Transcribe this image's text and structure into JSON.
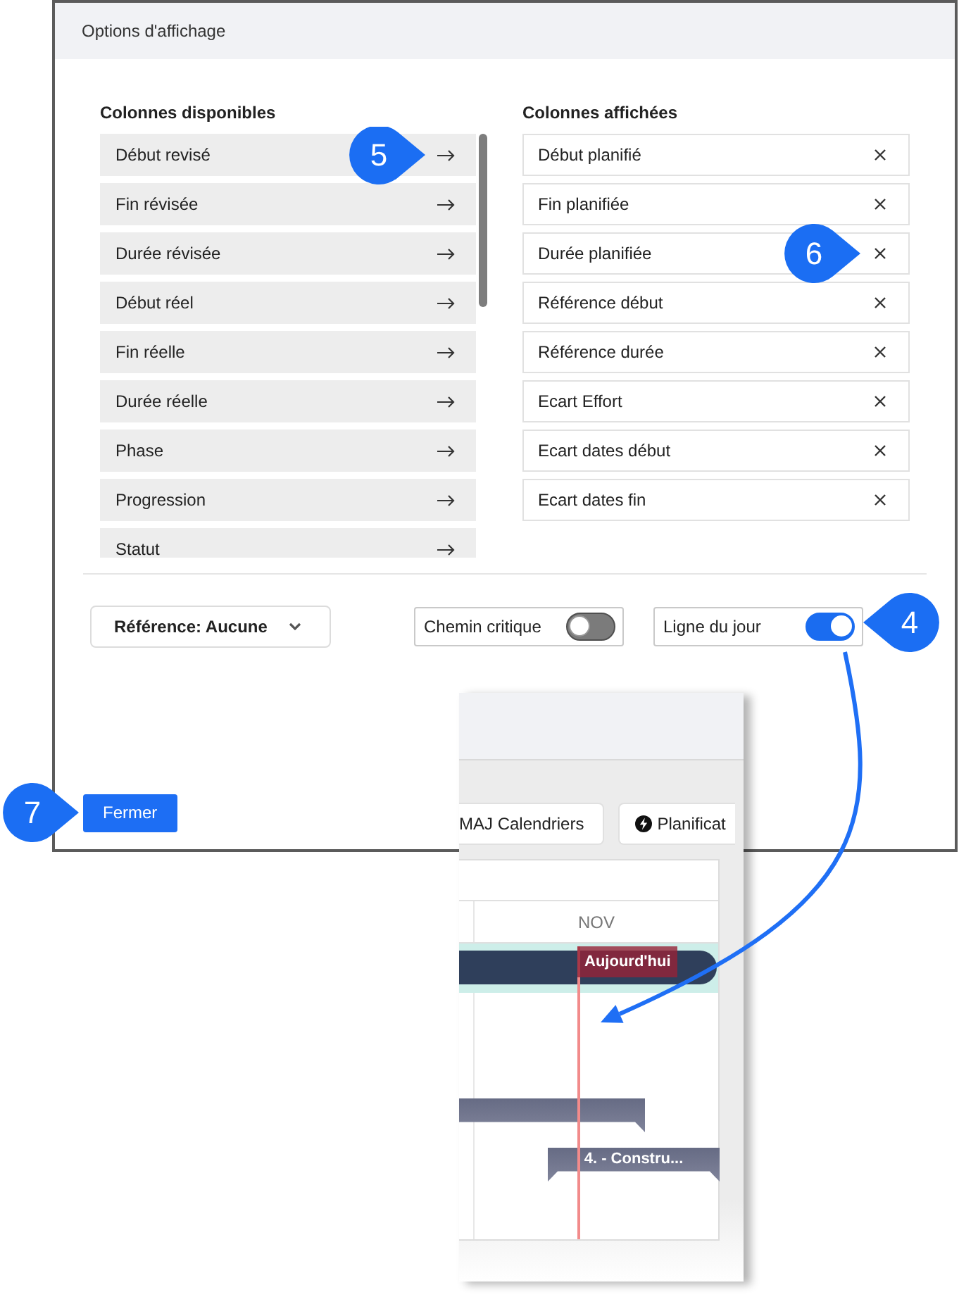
{
  "dialog": {
    "title": "Options d'affichage"
  },
  "available_columns": {
    "heading": "Colonnes disponibles",
    "items": [
      {
        "label": "Début revisé",
        "callout": "5"
      },
      {
        "label": "Fin révisée"
      },
      {
        "label": "Durée révisée"
      },
      {
        "label": "Début réel"
      },
      {
        "label": "Fin réelle"
      },
      {
        "label": "Durée réelle"
      },
      {
        "label": "Phase"
      },
      {
        "label": "Progression"
      },
      {
        "label": "Statut"
      }
    ]
  },
  "displayed_columns": {
    "heading": "Colonnes affichées",
    "items": [
      {
        "label": "Début planifié"
      },
      {
        "label": "Fin planifiée"
      },
      {
        "label": "Durée planifiée",
        "callout": "6"
      },
      {
        "label": "Référence début"
      },
      {
        "label": "Référence durée"
      },
      {
        "label": "Ecart Effort"
      },
      {
        "label": "Ecart dates début"
      },
      {
        "label": "Ecart dates fin"
      }
    ]
  },
  "reference_dropdown": {
    "label": "Référence: Aucune"
  },
  "toggles": [
    {
      "label": "Chemin critique",
      "on": false
    },
    {
      "label": "Ligne du jour",
      "on": true,
      "callout": "4"
    }
  ],
  "close_button": {
    "label": "Fermer",
    "callout": "7"
  },
  "gantt_inset": {
    "toolbar_buttons": [
      {
        "label": "MAJ Calendriers",
        "has_icon": false
      },
      {
        "label": "Planificat",
        "has_icon": true
      }
    ],
    "month": "NOV",
    "today_label": "Aujourd'hui",
    "rows": [
      {
        "kind": "summary",
        "selected": true
      },
      {
        "kind": "empty",
        "selected": false
      },
      {
        "kind": "empty",
        "selected": false
      },
      {
        "kind": "phase",
        "selected": false
      },
      {
        "kind": "phase",
        "label": "4. - Constru...",
        "selected": false
      },
      {
        "kind": "empty",
        "selected": false
      }
    ]
  }
}
